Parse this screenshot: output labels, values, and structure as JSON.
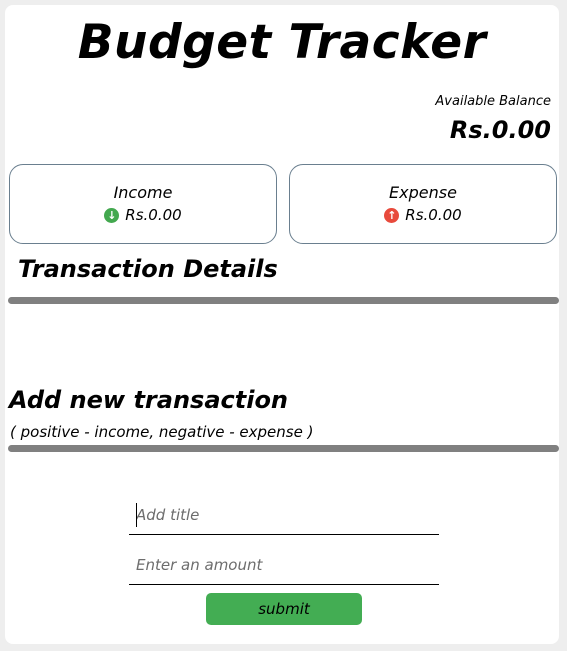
{
  "app": {
    "title": "Budget Tracker"
  },
  "balance": {
    "label": "Available Balance",
    "value": "Rs.0.00"
  },
  "summary": {
    "income": {
      "label": "Income",
      "amount": "Rs.0.00",
      "icon": "arrow-down-circle-icon",
      "color": "#43a84f"
    },
    "expense": {
      "label": "Expense",
      "amount": "Rs.0.00",
      "icon": "arrow-up-circle-icon",
      "color": "#e84a3c"
    }
  },
  "transactions": {
    "title": "Transaction Details",
    "items": []
  },
  "add_form": {
    "title": "Add new transaction",
    "hint": "( positive - income, negative - expense )",
    "title_field": {
      "placeholder": "Add title",
      "value": ""
    },
    "amount_field": {
      "placeholder": "Enter an amount",
      "value": ""
    },
    "submit_label": "submit",
    "submit_color": "#43ad53"
  }
}
